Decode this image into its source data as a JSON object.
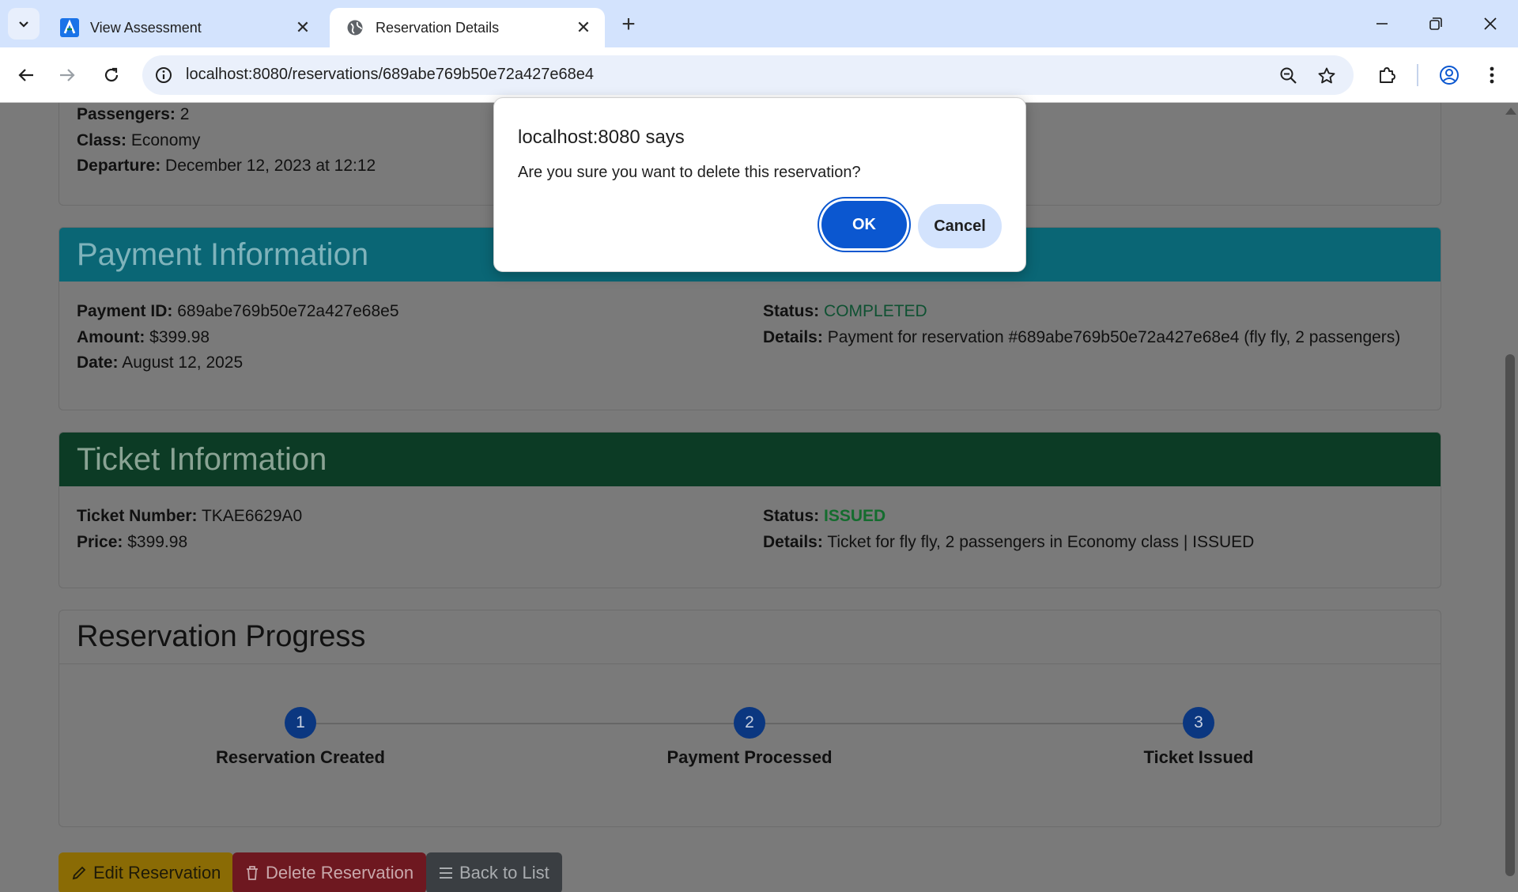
{
  "browser": {
    "tabs": [
      {
        "title": "View Assessment",
        "favicon": "app-logo-icon",
        "active": false
      },
      {
        "title": "Reservation Details",
        "favicon": "globe-icon",
        "active": true
      }
    ],
    "url": "localhost:8080/reservations/689abe769b50e72a427e68e4"
  },
  "page": {
    "flight": {
      "passengers_label": "Passengers:",
      "passengers_value": "2",
      "class_label": "Class:",
      "class_value": "Economy",
      "departure_label": "Departure:",
      "departure_value": "December 12, 2023 at 12:12"
    },
    "payment": {
      "title": "Payment Information",
      "id_label": "Payment ID:",
      "id_value": "689abe769b50e72a427e68e5",
      "amount_label": "Amount:",
      "amount_value": "$399.98",
      "date_label": "Date:",
      "date_value": "August 12, 2025",
      "status_label": "Status:",
      "status_value": "COMPLETED",
      "details_label": "Details:",
      "details_value": "Payment for reservation #689abe769b50e72a427e68e4 (fly fly, 2 passengers)"
    },
    "ticket": {
      "title": "Ticket Information",
      "number_label": "Ticket Number:",
      "number_value": "TKAE6629A0",
      "price_label": "Price:",
      "price_value": "$399.98",
      "status_label": "Status:",
      "status_value": "ISSUED",
      "details_label": "Details:",
      "details_value": "Ticket for fly fly, 2 passengers in Economy class | ISSUED"
    },
    "progress": {
      "title": "Reservation Progress",
      "steps": [
        {
          "num": "1",
          "label": "Reservation Created"
        },
        {
          "num": "2",
          "label": "Payment Processed"
        },
        {
          "num": "3",
          "label": "Ticket Issued"
        }
      ]
    },
    "actions": {
      "edit": "Edit Reservation",
      "delete": "Delete Reservation",
      "back": "Back to List"
    }
  },
  "dialog": {
    "title": "localhost:8080 says",
    "message": "Are you sure you want to delete this reservation?",
    "ok": "OK",
    "cancel": "Cancel"
  },
  "colors": {
    "payment_header": "#0a6675",
    "ticket_header": "#0c3b25",
    "completed_text": "#0f5132",
    "issued_text": "#146c2e",
    "step_circle": "#0b3780",
    "edit_button": "#8a6b05",
    "delete_button": "#6e1820",
    "back_button": "#3a3e42",
    "dialog_primary": "#0b57d0"
  }
}
